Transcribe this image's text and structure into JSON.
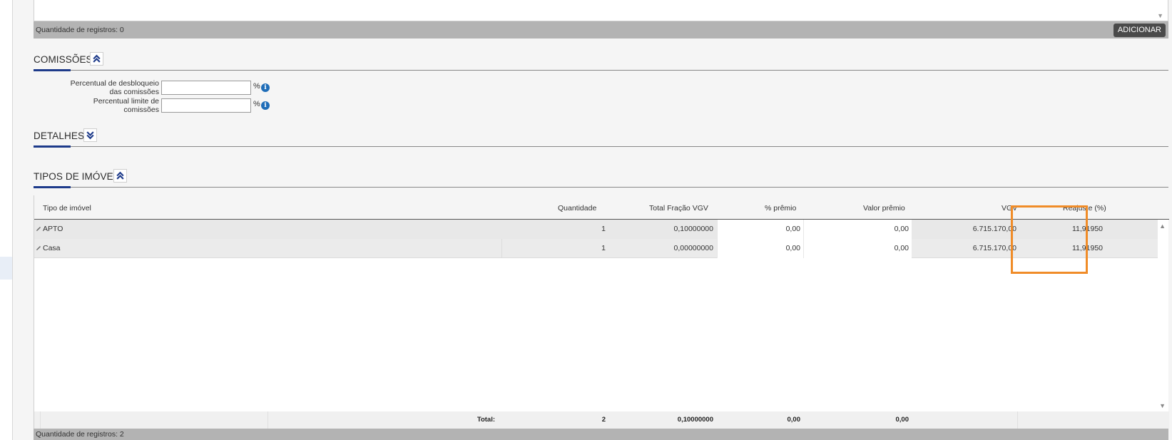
{
  "top_list": {
    "records_label": "Quantidade de registros: 0",
    "add_button": "ADICIONAR"
  },
  "commissions": {
    "title": "COMISSÕES",
    "fields": [
      {
        "label": "Percentual de desbloqueio das comissões",
        "value": "",
        "unit": "%"
      },
      {
        "label": "Percentual limite de comissões",
        "value": "",
        "unit": "%"
      }
    ]
  },
  "details": {
    "title": "DETALHES"
  },
  "property_types": {
    "title": "TIPOS DE IMÓVEL",
    "columns": [
      "Tipo de imóvel",
      "Quantidade",
      "Total Fração VGV",
      "% prêmio",
      "Valor prêmio",
      "VGV",
      "Reajuste (%)"
    ],
    "rows": [
      {
        "tipo": "APTO",
        "quantidade": "1",
        "fracao": "0,10000000",
        "premio_pct": "0,00",
        "premio_valor": "0,00",
        "vgv": "6.715.170,00",
        "reajuste": "11,91950"
      },
      {
        "tipo": "Casa",
        "quantidade": "1",
        "fracao": "0,00000000",
        "premio_pct": "0,00",
        "premio_valor": "0,00",
        "vgv": "6.715.170,00",
        "reajuste": "11,91950"
      }
    ],
    "totals": {
      "label": "Total:",
      "quantidade": "2",
      "fracao": "0,10000000",
      "premio_pct": "0,00",
      "premio_valor": "0,00"
    },
    "records_label": "Quantidade de registros: 2"
  },
  "colors": {
    "accent": "#1d3a8a",
    "highlight": "#f08c28",
    "info": "#1f6db8"
  }
}
